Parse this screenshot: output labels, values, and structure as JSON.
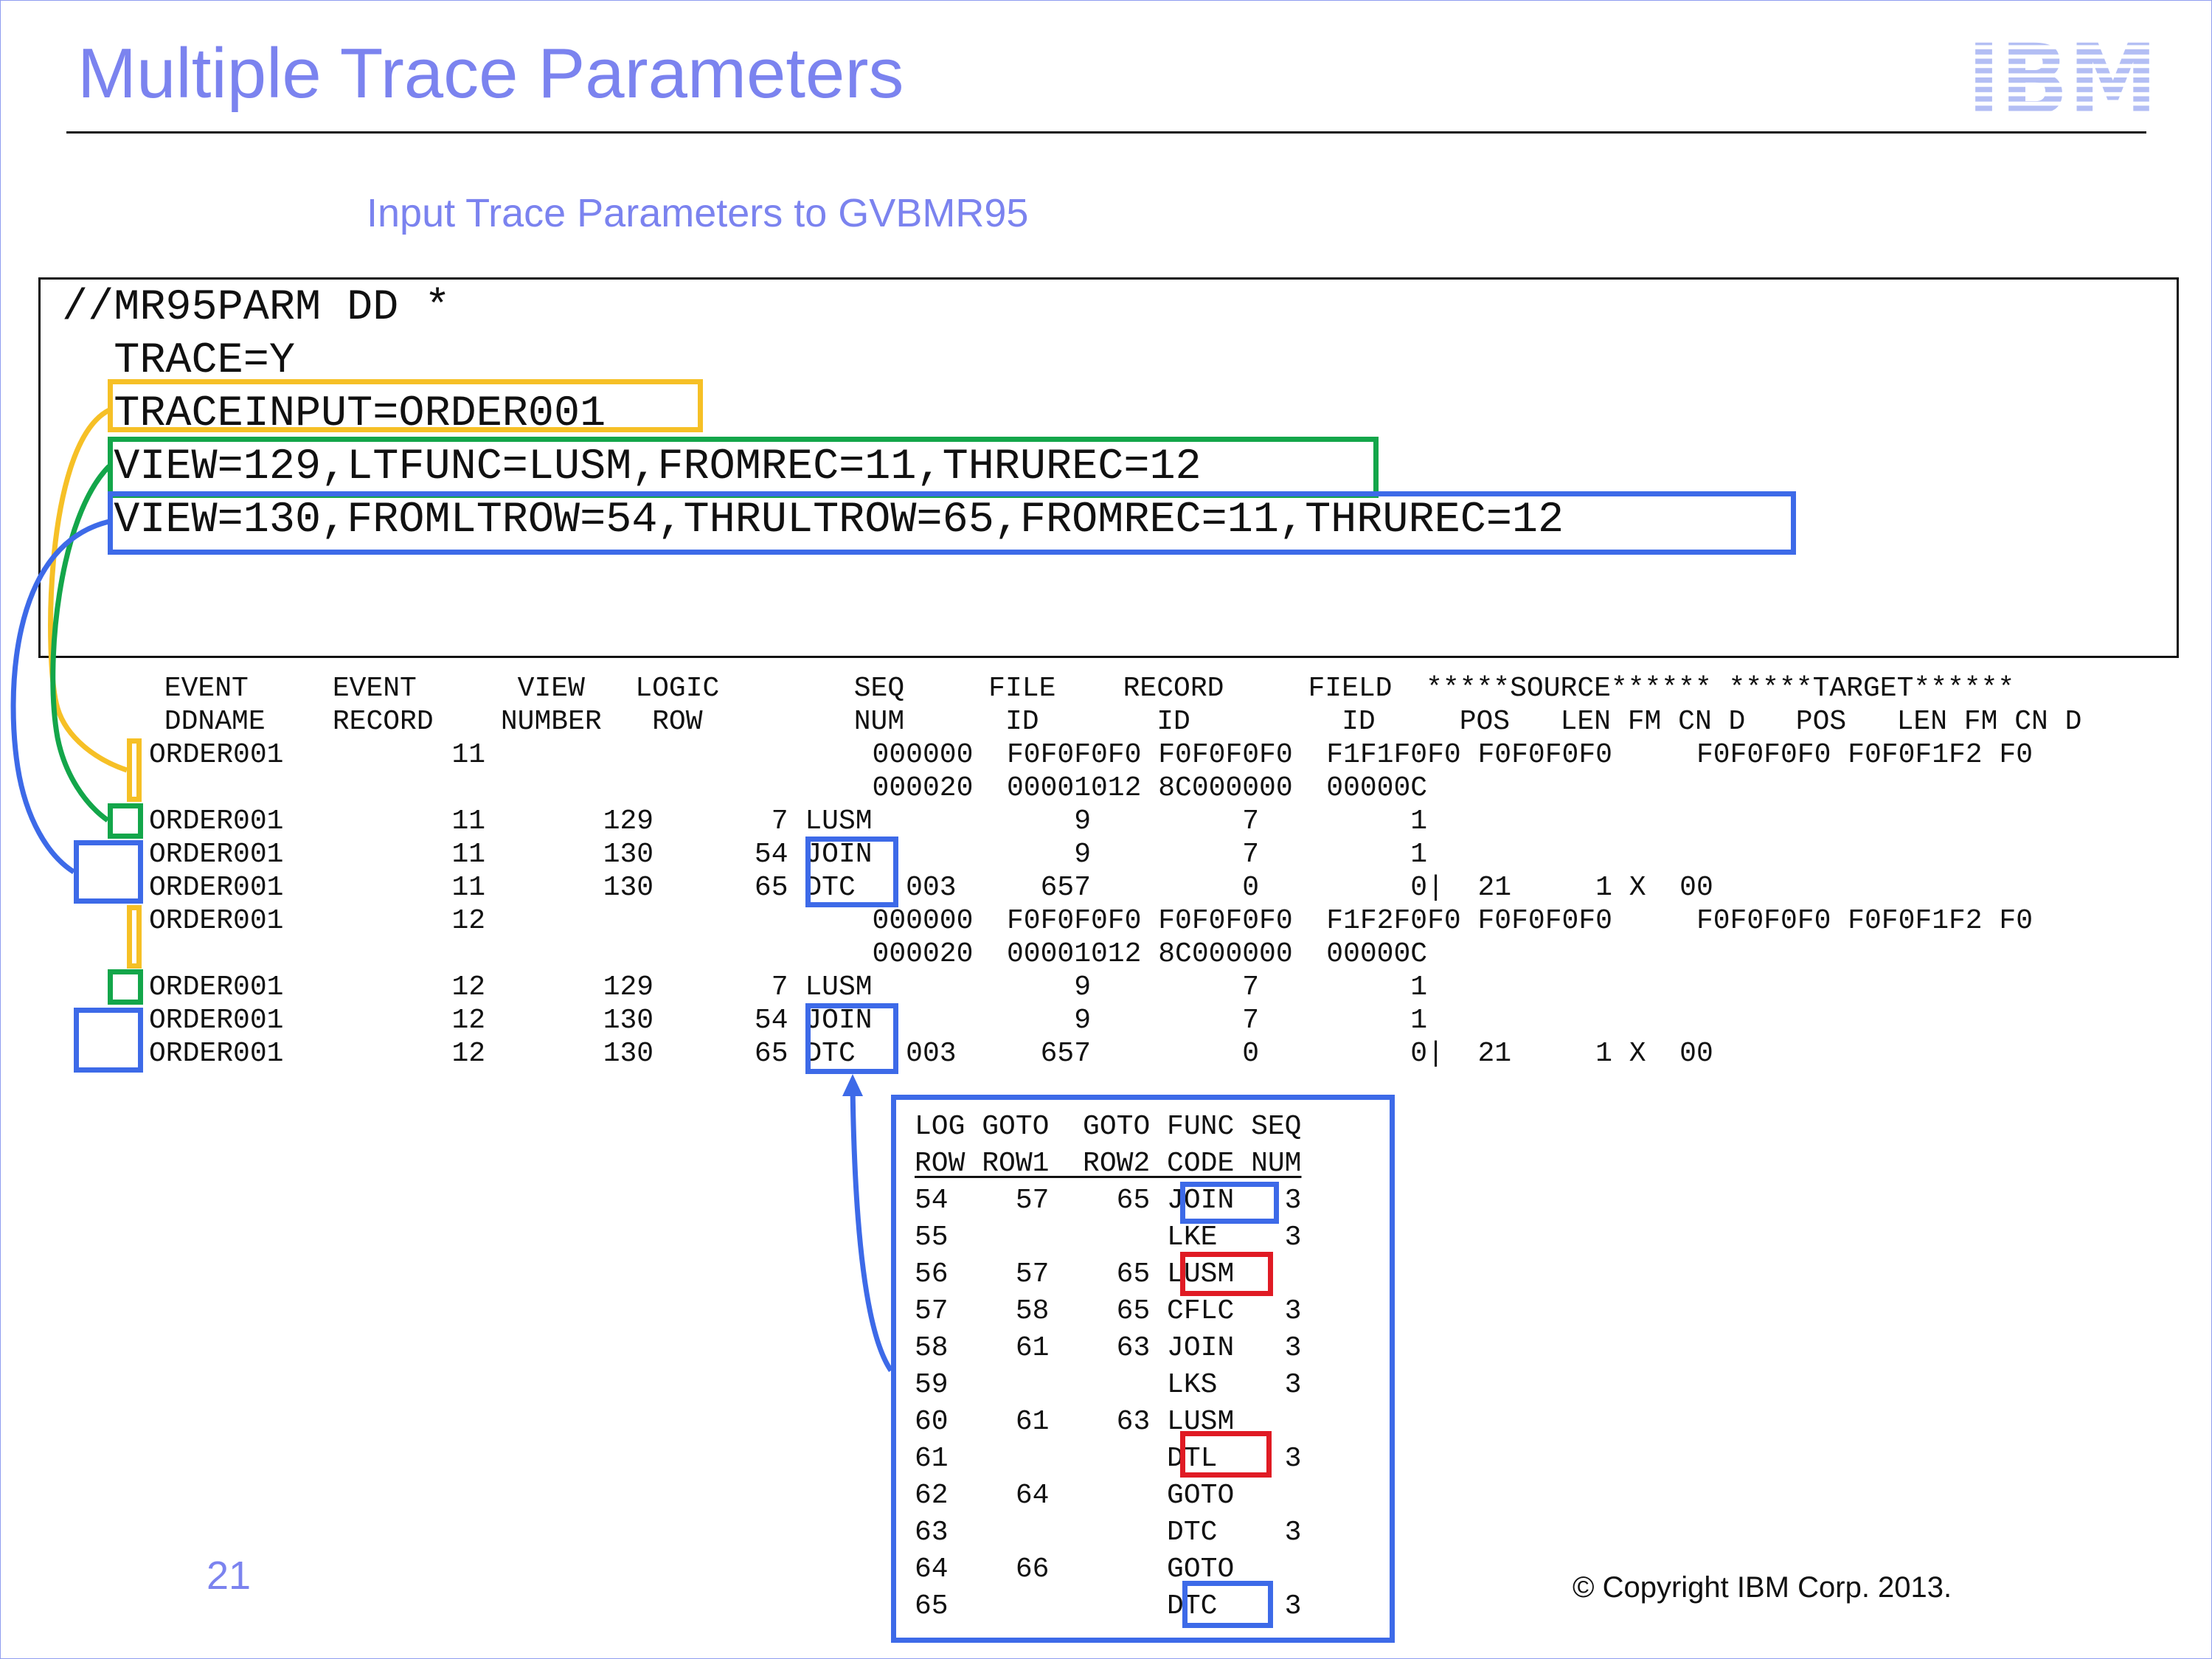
{
  "slide": {
    "title": "Multiple Trace Parameters",
    "subtitle": "Input Trace Parameters to GVBMR95",
    "logo_text": "IBM",
    "page_number": "21",
    "copyright": "© Copyright IBM Corp. 2013."
  },
  "colors": {
    "accent_text": "#7b83ef",
    "yellow": "#f6c026",
    "green": "#13a64a",
    "blue": "#3d6ae8",
    "red": "#e01b24"
  },
  "parm": {
    "lines": [
      "//MR95PARM DD *",
      "  TRACE=Y",
      "  TRACEINPUT=ORDER001",
      "  VIEW=129,LTFUNC=LUSM,FROMREC=11,THRUREC=12",
      "  VIEW=130,FROMLTROW=54,THRULTROW=65,FROMREC=11,THRUREC=12"
    ]
  },
  "trace": {
    "header1": " EVENT     EVENT      VIEW   LOGIC        SEQ     FILE    RECORD     FIELD  *****SOURCE****** *****TARGET******",
    "header2": " DDNAME    RECORD    NUMBER   ROW         NUM      ID       ID         ID     POS   LEN FM CN D   POS   LEN FM CN D",
    "rows": [
      "ORDER001          11                       000000  F0F0F0F0 F0F0F0F0  F1F1F0F0 F0F0F0F0     F0F0F0F0 F0F0F1F2 F0",
      "                                           000020  00001012 8C000000  00000C",
      "ORDER001          11       129       7 LUSM            9         7         1",
      "ORDER001          11       130      54 JOIN            9         7         1",
      "ORDER001          11       130      65 DTC   003     657         0         0|  21     1 X  00",
      "ORDER001          12                       000000  F0F0F0F0 F0F0F0F0  F1F2F0F0 F0F0F0F0     F0F0F0F0 F0F0F1F2 F0",
      "                                           000020  00001012 8C000000  00000C",
      "ORDER001          12       129       7 LUSM            9         7         1",
      "ORDER001          12       130      54 JOIN            9         7         1",
      "ORDER001          12       130      65 DTC   003     657         0         0|  21     1 X  00"
    ]
  },
  "logic_table": {
    "header1": "LOG GOTO  GOTO FUNC SEQ",
    "header2": "ROW ROW1  ROW2 CODE NUM",
    "rows": [
      "54    57    65 JOIN   3",
      "55             LKE    3",
      "56    57    65 LUSM",
      "57    58    65 CFLC   3",
      "58    61    63 JOIN   3",
      "59             LKS    3",
      "60    61    63 LUSM",
      "61             DTL    3",
      "62    64       GOTO",
      "63             DTC    3",
      "64    66       GOTO",
      "65             DTC    3"
    ]
  }
}
